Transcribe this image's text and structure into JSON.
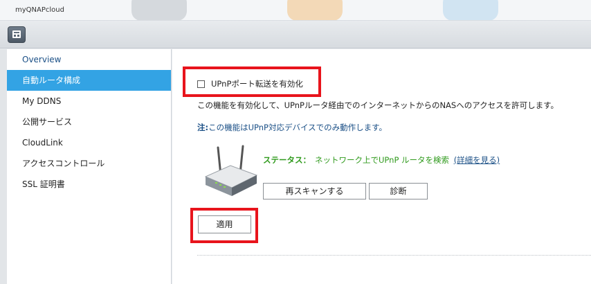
{
  "app": {
    "title": "myQNAPcloud"
  },
  "toolbar": {
    "menu_icon": "window-layout-icon"
  },
  "sidebar": {
    "items": [
      {
        "label": "Overview"
      },
      {
        "label": "自動ルータ構成"
      },
      {
        "label": "My DDNS"
      },
      {
        "label": "公開サービス"
      },
      {
        "label": "CloudLink"
      },
      {
        "label": "アクセスコントロール"
      },
      {
        "label": "SSL 証明書"
      }
    ],
    "active_index": 1
  },
  "main": {
    "upnp_checkbox_label": "UPnPポート転送を有効化",
    "upnp_checked": false,
    "description": "この機能を有効化して、UPnPルータ経由でのインターネットからのNASへのアクセスを許可します。",
    "note_prefix": "注:",
    "note_text": "この機能はUPnP対応デバイスでのみ動作します。",
    "status_label": "ステータス：",
    "status_value": "ネットワーク上でUPnP ルータを検索",
    "details_link": "(詳細を見る)",
    "rescan_button": "再スキャンする",
    "diagnose_button": "診断",
    "apply_button": "適用"
  },
  "colors": {
    "accent": "#33a3e4",
    "highlight": "#e8141c",
    "status_green": "#2f9a1c",
    "link_blue": "#1a4f86"
  }
}
